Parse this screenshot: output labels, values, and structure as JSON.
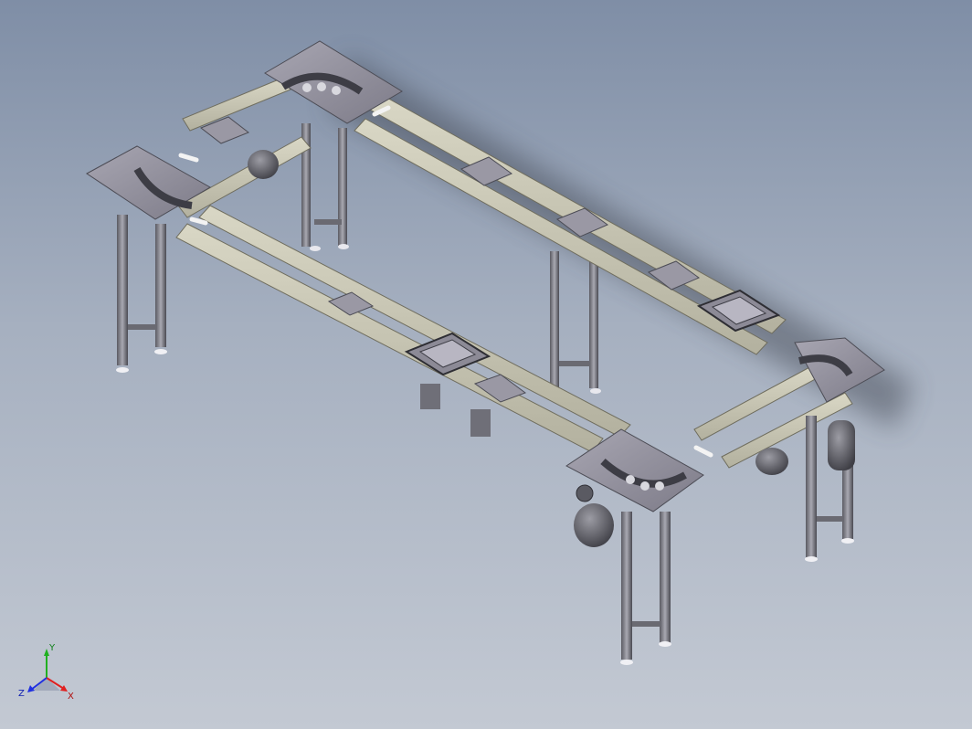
{
  "viewport": {
    "background_top": "#7f8ea6",
    "background_bottom": "#c3c9d3"
  },
  "model": {
    "icon": "conveyor-frame-assembly-icon",
    "colors": {
      "frame": "#c9c7b4",
      "frame_edge": "#6f6d5e",
      "metal": "#8b8a92",
      "metal_dark": "#4c4c55",
      "plate": "#9a98a4"
    }
  },
  "triad": {
    "x_label": "X",
    "y_label": "Y",
    "z_label": "Z",
    "x_color": "#e02020",
    "y_color": "#20b020",
    "z_color": "#2030e0"
  }
}
